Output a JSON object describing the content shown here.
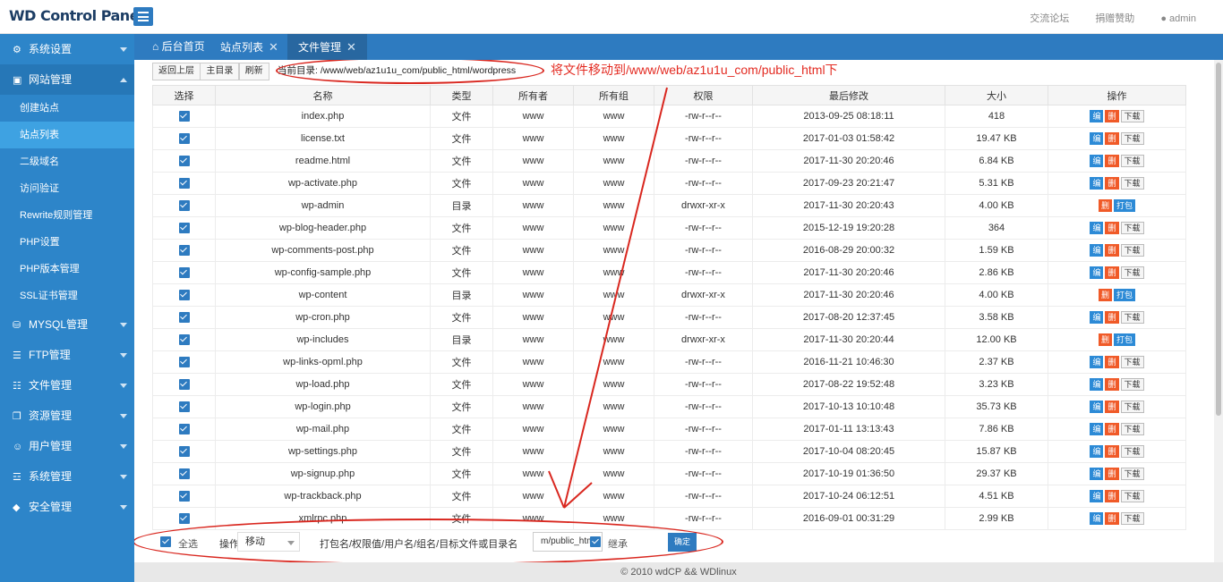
{
  "header": {
    "logo": "WD Control Panel",
    "links": [
      "交流论坛",
      "捐赠赞助",
      "admin"
    ]
  },
  "sidebar": {
    "groups": [
      {
        "label": "系统设置",
        "icon": "gear-icon"
      },
      {
        "label": "网站管理",
        "icon": "monitor-icon",
        "open": true
      },
      {
        "label": "MYSQL管理",
        "icon": "database-icon"
      },
      {
        "label": "FTP管理",
        "icon": "ftp-icon"
      },
      {
        "label": "文件管理",
        "icon": "file-icon"
      },
      {
        "label": "资源管理",
        "icon": "resource-icon"
      },
      {
        "label": "用户管理",
        "icon": "user-icon"
      },
      {
        "label": "系统管理",
        "icon": "settings-icon"
      },
      {
        "label": "安全管理",
        "icon": "shield-icon"
      }
    ],
    "subitems": [
      "创建站点",
      "站点列表",
      "二级域名",
      "访问验证",
      "Rewrite规则管理",
      "PHP设置",
      "PHP版本管理",
      "SSL证书管理"
    ],
    "active_sub": "站点列表"
  },
  "tabs": [
    {
      "label": "后台首页",
      "icon": "home-icon"
    },
    {
      "label": "站点列表",
      "closable": true
    },
    {
      "label": "文件管理",
      "closable": true,
      "active": true
    }
  ],
  "toolbar": {
    "up": "返回上层",
    "root": "主目录",
    "refresh": "刷新",
    "path_label": "当前目录: /www/web/az1u1u_com/public_html/wordpress"
  },
  "annotation": "将文件移动到/www/web/az1u1u_com/public_html下",
  "table": {
    "headers": [
      "选择",
      "名称",
      "类型",
      "所有者",
      "所有组",
      "权限",
      "最后修改",
      "大小",
      "操作"
    ],
    "action_labels": {
      "edit": "编",
      "delete": "删",
      "download": "下载",
      "pack": "打包"
    },
    "rows": [
      {
        "name": "index.php",
        "type": "文件",
        "owner": "www",
        "group": "www",
        "perm": "-rw-r--r--",
        "mtime": "2013-09-25 08:18:11",
        "size": "418",
        "dir": false
      },
      {
        "name": "license.txt",
        "type": "文件",
        "owner": "www",
        "group": "www",
        "perm": "-rw-r--r--",
        "mtime": "2017-01-03 01:58:42",
        "size": "19.47 KB",
        "dir": false
      },
      {
        "name": "readme.html",
        "type": "文件",
        "owner": "www",
        "group": "www",
        "perm": "-rw-r--r--",
        "mtime": "2017-11-30 20:20:46",
        "size": "6.84 KB",
        "dir": false
      },
      {
        "name": "wp-activate.php",
        "type": "文件",
        "owner": "www",
        "group": "www",
        "perm": "-rw-r--r--",
        "mtime": "2017-09-23 20:21:47",
        "size": "5.31 KB",
        "dir": false
      },
      {
        "name": "wp-admin",
        "type": "目录",
        "owner": "www",
        "group": "www",
        "perm": "drwxr-xr-x",
        "mtime": "2017-11-30 20:20:43",
        "size": "4.00 KB",
        "dir": true
      },
      {
        "name": "wp-blog-header.php",
        "type": "文件",
        "owner": "www",
        "group": "www",
        "perm": "-rw-r--r--",
        "mtime": "2015-12-19 19:20:28",
        "size": "364",
        "dir": false
      },
      {
        "name": "wp-comments-post.php",
        "type": "文件",
        "owner": "www",
        "group": "www",
        "perm": "-rw-r--r--",
        "mtime": "2016-08-29 20:00:32",
        "size": "1.59 KB",
        "dir": false
      },
      {
        "name": "wp-config-sample.php",
        "type": "文件",
        "owner": "www",
        "group": "www",
        "perm": "-rw-r--r--",
        "mtime": "2017-11-30 20:20:46",
        "size": "2.86 KB",
        "dir": false
      },
      {
        "name": "wp-content",
        "type": "目录",
        "owner": "www",
        "group": "www",
        "perm": "drwxr-xr-x",
        "mtime": "2017-11-30 20:20:46",
        "size": "4.00 KB",
        "dir": true
      },
      {
        "name": "wp-cron.php",
        "type": "文件",
        "owner": "www",
        "group": "www",
        "perm": "-rw-r--r--",
        "mtime": "2017-08-20 12:37:45",
        "size": "3.58 KB",
        "dir": false
      },
      {
        "name": "wp-includes",
        "type": "目录",
        "owner": "www",
        "group": "www",
        "perm": "drwxr-xr-x",
        "mtime": "2017-11-30 20:20:44",
        "size": "12.00 KB",
        "dir": true
      },
      {
        "name": "wp-links-opml.php",
        "type": "文件",
        "owner": "www",
        "group": "www",
        "perm": "-rw-r--r--",
        "mtime": "2016-11-21 10:46:30",
        "size": "2.37 KB",
        "dir": false
      },
      {
        "name": "wp-load.php",
        "type": "文件",
        "owner": "www",
        "group": "www",
        "perm": "-rw-r--r--",
        "mtime": "2017-08-22 19:52:48",
        "size": "3.23 KB",
        "dir": false
      },
      {
        "name": "wp-login.php",
        "type": "文件",
        "owner": "www",
        "group": "www",
        "perm": "-rw-r--r--",
        "mtime": "2017-10-13 10:10:48",
        "size": "35.73 KB",
        "dir": false
      },
      {
        "name": "wp-mail.php",
        "type": "文件",
        "owner": "www",
        "group": "www",
        "perm": "-rw-r--r--",
        "mtime": "2017-01-11 13:13:43",
        "size": "7.86 KB",
        "dir": false
      },
      {
        "name": "wp-settings.php",
        "type": "文件",
        "owner": "www",
        "group": "www",
        "perm": "-rw-r--r--",
        "mtime": "2017-10-04 08:20:45",
        "size": "15.87 KB",
        "dir": false
      },
      {
        "name": "wp-signup.php",
        "type": "文件",
        "owner": "www",
        "group": "www",
        "perm": "-rw-r--r--",
        "mtime": "2017-10-19 01:36:50",
        "size": "29.37 KB",
        "dir": false
      },
      {
        "name": "wp-trackback.php",
        "type": "文件",
        "owner": "www",
        "group": "www",
        "perm": "-rw-r--r--",
        "mtime": "2017-10-24 06:12:51",
        "size": "4.51 KB",
        "dir": false
      },
      {
        "name": "xmlrpc.php",
        "type": "文件",
        "owner": "www",
        "group": "www",
        "perm": "-rw-r--r--",
        "mtime": "2016-09-01 00:31:29",
        "size": "2.99 KB",
        "dir": false
      }
    ]
  },
  "bottom": {
    "select_all": "全选",
    "op_label": "操作",
    "op_value": "移动",
    "target_label": "打包名/权限值/用户名/组名/目标文件或目录名",
    "target_value": "m/public_html",
    "inherit": "继承",
    "confirm": "确定"
  },
  "footer": "© 2010 wdCP && WDlinux"
}
